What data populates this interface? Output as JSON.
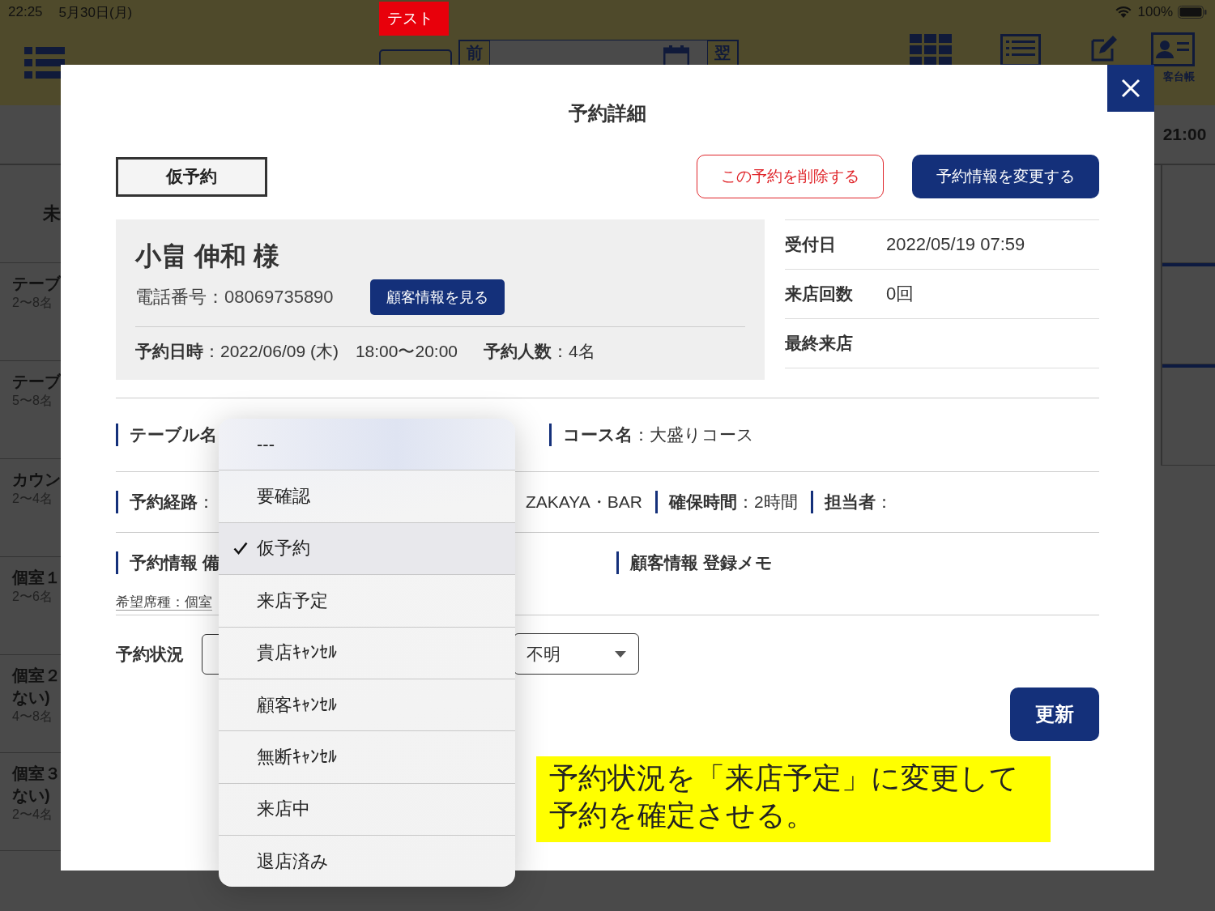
{
  "status_bar": {
    "time": "22:25",
    "date": "5月30日(月)",
    "battery": "100%"
  },
  "header": {
    "badge": "テスト",
    "prev": "前",
    "next": "翌",
    "customer_book": "客台帳"
  },
  "timeline": {
    "time_label": "21:00",
    "header_cell": "未",
    "rows": [
      {
        "name": "テーブ",
        "capacity": "2〜8名"
      },
      {
        "name": "テーブ",
        "capacity": "5〜8名"
      },
      {
        "name": "カウン",
        "capacity": "2〜4名"
      },
      {
        "name": "個室１",
        "capacity": "2〜6名"
      },
      {
        "name": "個室２",
        "note": "ない)",
        "capacity": "4〜8名"
      },
      {
        "name": "個室３",
        "note": "ない)",
        "capacity": "2〜4名"
      }
    ]
  },
  "modal": {
    "title": "予約詳細",
    "status_tag": "仮予約",
    "delete_button": "この予約を削除する",
    "edit_button": "予約情報を変更する",
    "customer": {
      "name": "小畠 伸和 様",
      "phone": "電話番号：08069735890",
      "info_button": "顧客情報を見る",
      "datetime": "**予約日時**：2022/06/09 (木)　18:00〜20:00",
      "party": "**予約人数**：4名"
    },
    "stats": [
      {
        "label": "受付日",
        "value": "2022/05/19 07:59"
      },
      {
        "label": "来店回数",
        "value": "0回"
      },
      {
        "label": "最終来店"
      }
    ],
    "table_label": "テーブル名",
    "course": "**コース名**：大盛りコース",
    "route": "**予約経路**：",
    "route_value": "ZAKAYA・BAR",
    "duration": "**確保時間**：2時間",
    "staff": "**担当者**：",
    "memo_label": "予約情報 備",
    "customer_memo_label": "顧客情報 登録メモ",
    "seat_request": "希望席種：個室",
    "status_label": "予約状況",
    "second_select": "不明",
    "update_button": "更新"
  },
  "dropdown": {
    "options": [
      {
        "label": "---",
        "selected": false
      },
      {
        "label": "要確認",
        "selected": false
      },
      {
        "label": "仮予約",
        "selected": true
      },
      {
        "label": "来店予定",
        "selected": false
      },
      {
        "label": "貴店ｷｬﾝｾﾙ",
        "selected": false
      },
      {
        "label": "顧客ｷｬﾝｾﾙ",
        "selected": false
      },
      {
        "label": "無断ｷｬﾝｾﾙ",
        "selected": false
      },
      {
        "label": "来店中",
        "selected": false
      },
      {
        "label": "退店済み",
        "selected": false
      }
    ]
  },
  "annotation": {
    "lines": [
      "予約状況を「来店予定」に変更して",
      "予約を確定させる。"
    ]
  }
}
